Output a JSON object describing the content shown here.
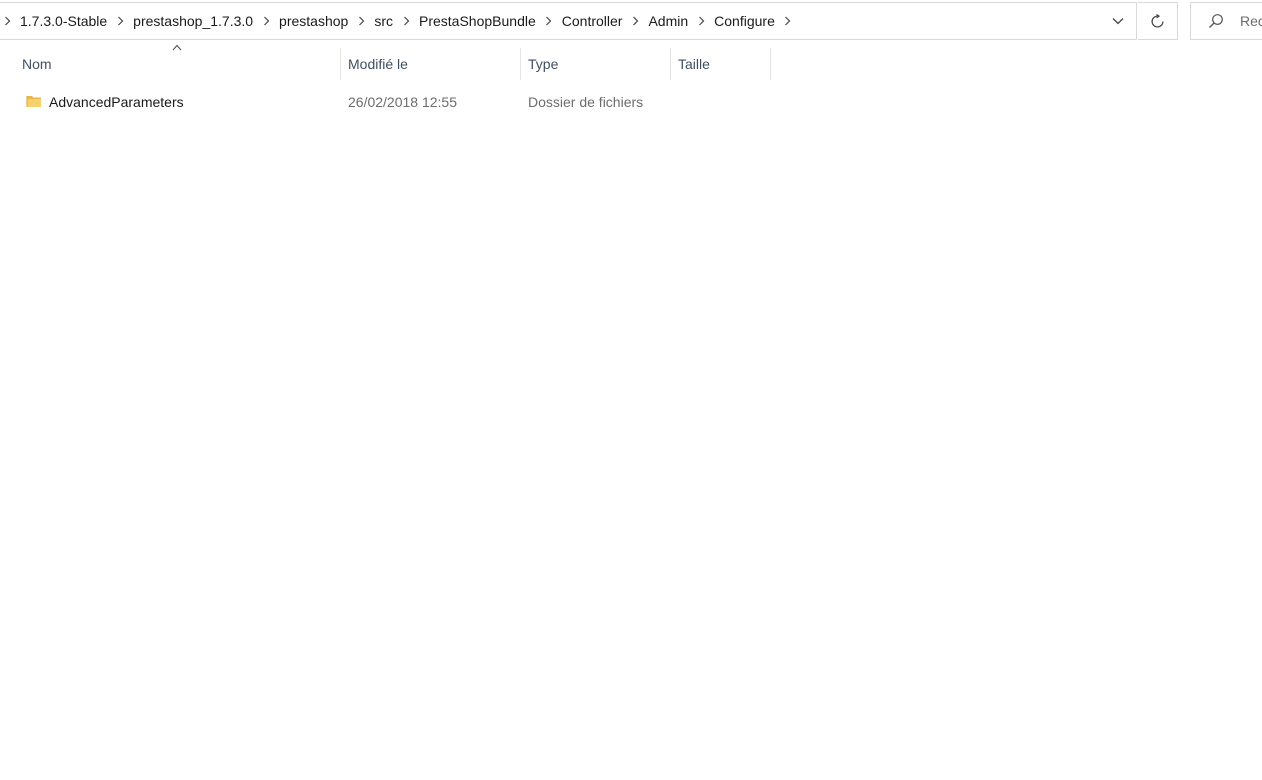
{
  "window_title": "",
  "address_bar": {
    "breadcrumbs": [
      {
        "label": "1.7.3.0-Stable"
      },
      {
        "label": "prestashop_1.7.3.0"
      },
      {
        "label": "prestashop"
      },
      {
        "label": "src"
      },
      {
        "label": "PrestaShopBundle"
      },
      {
        "label": "Controller"
      },
      {
        "label": "Admin"
      },
      {
        "label": "Configure"
      }
    ],
    "dropdown_icon": "chevron-down-icon",
    "separator_icon": "chevron-right-icon"
  },
  "refresh": {
    "icon": "refresh-icon"
  },
  "search": {
    "icon": "search-icon",
    "placeholder": "Rechercher dans : Configure"
  },
  "columns": {
    "name": "Nom",
    "modified": "Modifié le",
    "type": "Type",
    "size": "Taille",
    "sort_icon": "sort-ascending-icon"
  },
  "files": [
    {
      "icon": "folder-icon",
      "name": "AdvancedParameters",
      "modified": "26/02/2018 12:55",
      "type": "Dossier de fichiers",
      "size": ""
    }
  ],
  "colors": {
    "folder": "#f2c94c",
    "header_text": "#3f4f62",
    "secondary_text": "#6d6d6d",
    "border": "#d9d9d9"
  }
}
